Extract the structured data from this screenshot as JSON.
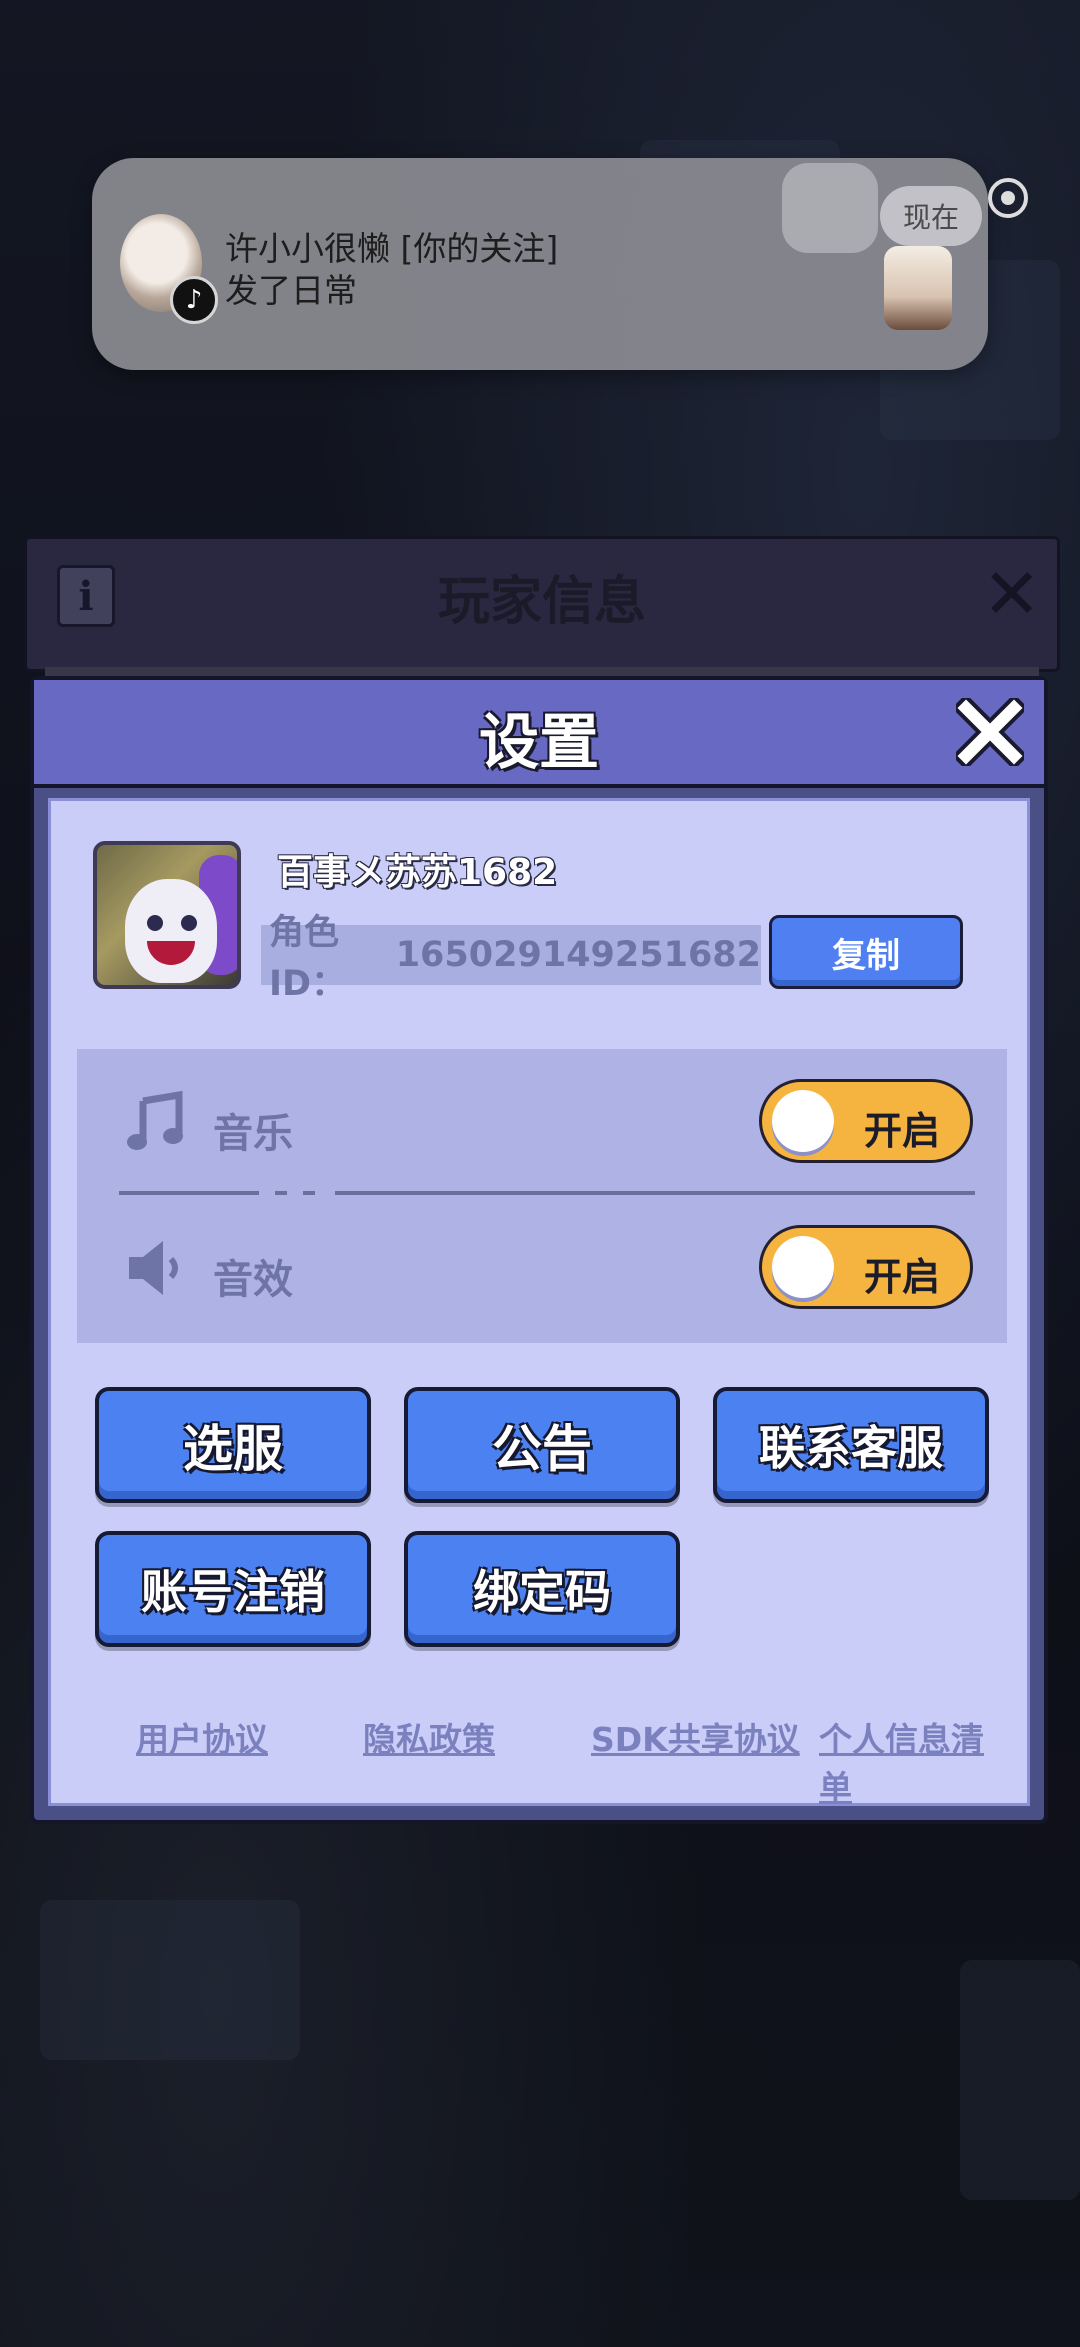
{
  "notification": {
    "title": "许小小很懒 [你的关注]",
    "body": "发了日常",
    "time": "现在"
  },
  "background_panel": {
    "title": "玩家信息"
  },
  "settings": {
    "title": "设置",
    "player": {
      "name": "百事メ苏苏1682",
      "id_label": "角色ID：",
      "id_value": "165029149251682",
      "copy_label": "复制"
    },
    "audio": {
      "music": {
        "label": "音乐",
        "state": "开启",
        "icon": "music-note-icon"
      },
      "sfx": {
        "label": "音效",
        "state": "开启",
        "icon": "speaker-icon"
      }
    },
    "buttons": {
      "server_select": "选服",
      "announcement": "公告",
      "contact_support": "联系客服",
      "account_delete": "账号注销",
      "bind_code": "绑定码"
    },
    "links": {
      "user_agreement": "用户协议",
      "privacy_policy": "隐私政策",
      "sdk_sharing": "SDK共享协议",
      "personal_info_list": "个人信息清单"
    },
    "colors": {
      "header": "#6769c2",
      "panel": "#c9cdf7",
      "button": "#4c81f2",
      "toggle_on": "#f5b440"
    }
  }
}
